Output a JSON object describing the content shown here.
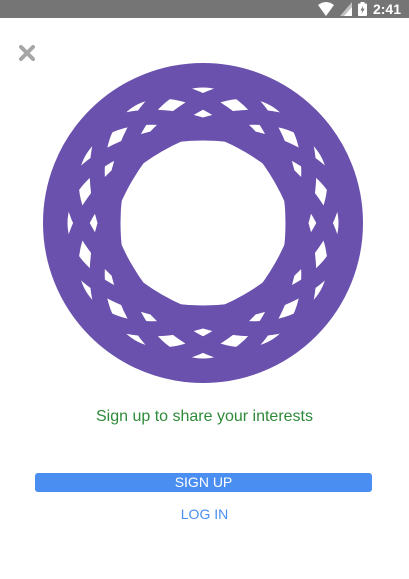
{
  "status_bar": {
    "time": "2:41",
    "icons": [
      "wifi-icon",
      "signal-icon",
      "battery-charging-icon"
    ]
  },
  "close_icon": "close-icon",
  "logo_icon": "interests-logo-icon",
  "tagline": "Sign up to share your interests",
  "signup_label": "SIGN UP",
  "login_label": "LOG IN",
  "colors": {
    "status_bar": "#757575",
    "logo": "#6a51ad",
    "tagline": "#2e8b3a",
    "accent": "#4a8ef2"
  }
}
